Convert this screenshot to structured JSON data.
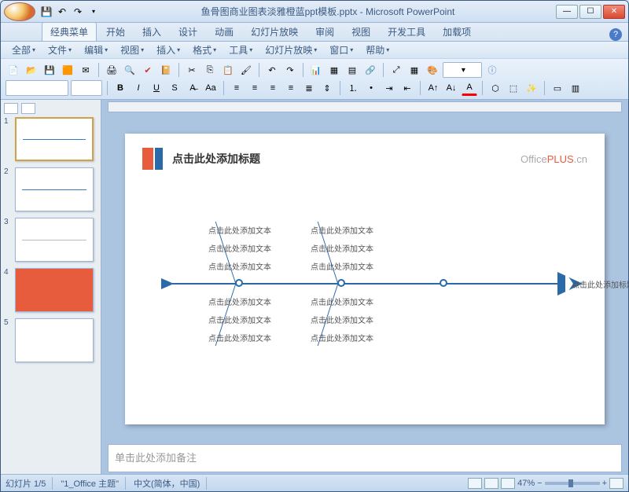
{
  "title": "鱼骨图商业图表淡雅橙蓝ppt模板.pptx - Microsoft PowerPoint",
  "ribbon_tabs": [
    "经典菜单",
    "开始",
    "插入",
    "设计",
    "动画",
    "幻灯片放映",
    "审阅",
    "视图",
    "开发工具",
    "加载项"
  ],
  "menubar": [
    "全部",
    "文件",
    "编辑",
    "视图",
    "插入",
    "格式",
    "工具",
    "幻灯片放映",
    "窗口",
    "帮助"
  ],
  "slide": {
    "title": "点击此处添加标题",
    "brand_prefix": "Office",
    "brand_suffix": "PLUS",
    "brand_ext": ".cn",
    "text_item": "点击此处添加文本",
    "end_label": "点击此处添加标题"
  },
  "notes_placeholder": "单击此处添加备注",
  "status": {
    "slide_pos": "幻灯片 1/5",
    "theme": "\"1_Office 主题\"",
    "lang": "中文(简体，中国)",
    "zoom": "47%"
  },
  "thumbs": [
    1,
    2,
    3,
    4,
    5
  ]
}
